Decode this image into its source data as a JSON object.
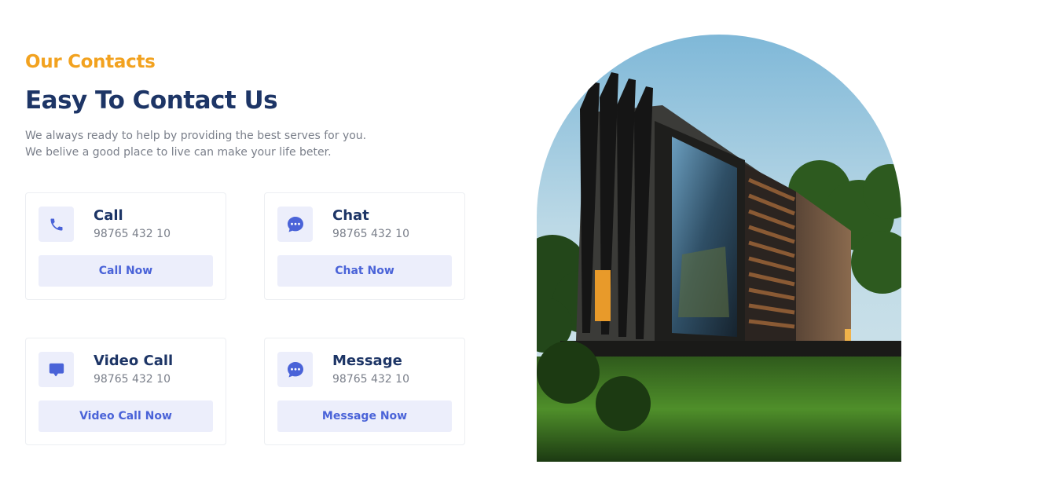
{
  "header": {
    "eyebrow": "Our Contacts",
    "title": "Easy To Contact Us",
    "description_lines": [
      "We always ready to help by providing the best serves for you.",
      "We belive a good place to live can make your life beter."
    ]
  },
  "cards": [
    {
      "icon": "phone-icon",
      "title": "Call",
      "number": "98765 432 10",
      "button": "Call Now"
    },
    {
      "icon": "chat-bubble-icon",
      "title": "Chat",
      "number": "98765 432 10",
      "button": "Chat Now"
    },
    {
      "icon": "video-chat-icon",
      "title": "Video Call",
      "number": "98765 432 10",
      "button": "Video Call Now"
    },
    {
      "icon": "message-bubble-icon",
      "title": "Message",
      "number": "98765 432 10",
      "button": "Message Now"
    }
  ],
  "colors": {
    "accent": "#f2a21f",
    "heading": "#1d3566",
    "primary": "#4a63d8",
    "button_bg": "#eceefb"
  }
}
